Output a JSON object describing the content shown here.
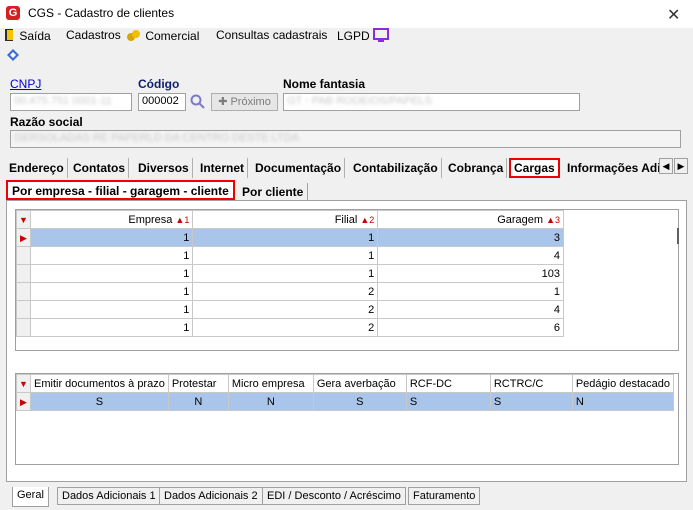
{
  "window": {
    "title": "CGS - Cadastro de clientes",
    "close_glyph": "✕",
    "logo_letter": "G"
  },
  "menu": [
    {
      "label": "Saída",
      "icon": "exit-door-icon"
    },
    {
      "label": "Cadastros",
      "icon": ""
    },
    {
      "label": "Comercial",
      "icon": "coins-icon"
    },
    {
      "label": "Consultas cadastrais",
      "icon": ""
    },
    {
      "label": "LGPD",
      "icon": "monitor-icon"
    }
  ],
  "form": {
    "cnpj_label": "CNPJ",
    "cnpj_value": "00.475.751 0001-11",
    "codigo_label": "Código",
    "codigo_value": "000002",
    "next_button_label": "Próximo",
    "nome_fantasia_label": "Nome fantasia",
    "nome_fantasia_value": "GT - PAB RODEIOS/PAPELS",
    "razao_social_label": "Razão social",
    "razao_social_value": "GERSOLADAS RE PAPERLD DA CENTRO DESTE LTDA"
  },
  "tabs": [
    "Endereço",
    "Contatos",
    "Diversos",
    "Internet",
    "Documentação",
    "Contabilização",
    "Cobrança",
    "Cargas",
    "Informações Adi"
  ],
  "active_tab": "Cargas",
  "subtabs": [
    "Por empresa - filial - garagem - cliente",
    "Por cliente"
  ],
  "grid1": {
    "columns": [
      {
        "label": "Empresa",
        "sort": "1"
      },
      {
        "label": "Filial",
        "sort": "2"
      },
      {
        "label": "Garagem",
        "sort": "3"
      }
    ],
    "rows": [
      [
        "1",
        "1",
        "3"
      ],
      [
        "1",
        "1",
        "4"
      ],
      [
        "1",
        "1",
        "103"
      ],
      [
        "1",
        "2",
        "1"
      ],
      [
        "1",
        "2",
        "4"
      ],
      [
        "1",
        "2",
        "6"
      ]
    ]
  },
  "grid2": {
    "columns": [
      "Emitir documentos à prazo",
      "Protestar",
      "Micro empresa",
      "Gera averbação",
      "RCF-DC",
      "RCTRC/C",
      "Pedágio destacado"
    ],
    "rows": [
      [
        "S",
        "N",
        "N",
        "S",
        "S",
        "S",
        "N"
      ]
    ]
  },
  "bottom_tabs": [
    "Geral",
    "Dados Adicionais 1",
    "Dados Adicionais 2",
    "EDI / Desconto / Acréscimo",
    "Faturamento"
  ],
  "colors": {
    "accent_red": "#e00000",
    "selection": "#a9c6ea",
    "link_blue": "#0000cc"
  }
}
